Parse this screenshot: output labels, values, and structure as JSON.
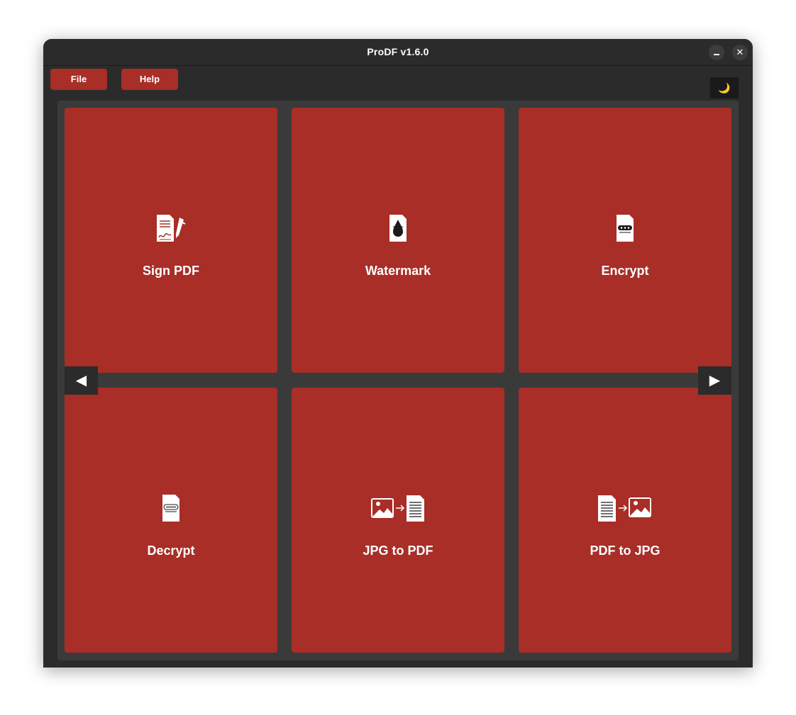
{
  "window": {
    "title": "ProDF v1.6.0",
    "minimize_label": "",
    "close_label": "✕"
  },
  "menu": {
    "file_label": "File",
    "help_label": "Help",
    "theme_icon": "moon-icon",
    "theme_glyph": "🌙"
  },
  "navigation": {
    "prev_glyph": "◀",
    "next_glyph": "▶"
  },
  "tools": [
    {
      "label": "Sign PDF",
      "icon": "sign-pdf-icon"
    },
    {
      "label": "Watermark",
      "icon": "watermark-icon"
    },
    {
      "label": "Encrypt",
      "icon": "encrypt-icon"
    },
    {
      "label": "Decrypt",
      "icon": "decrypt-icon"
    },
    {
      "label": "JPG to PDF",
      "icon": "jpg-to-pdf-icon"
    },
    {
      "label": "PDF to JPG",
      "icon": "pdf-to-jpg-icon"
    }
  ],
  "colors": {
    "accent": "#a82e27",
    "window_bg": "#2b2b2b",
    "panel_bg": "#3a3a3a",
    "text": "#ffffff"
  }
}
